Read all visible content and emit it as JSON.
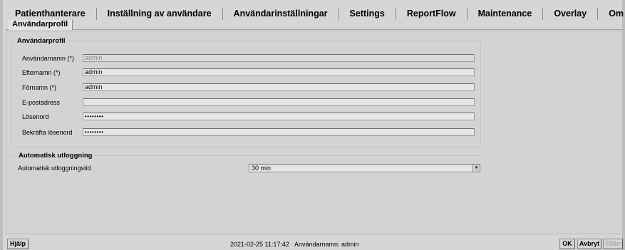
{
  "tabs": [
    {
      "label": "Patienthanterare"
    },
    {
      "label": "Inställning av användare"
    },
    {
      "label": "Användarinställningar"
    },
    {
      "label": "Settings"
    },
    {
      "label": "ReportFlow"
    },
    {
      "label": "Maintenance"
    },
    {
      "label": "Overlay"
    },
    {
      "label": "Om"
    }
  ],
  "subtab": {
    "label": "Användarprofil"
  },
  "profile": {
    "title": "Användarprofil",
    "fields": [
      {
        "label": "Användarnamn (*)",
        "value": "admin",
        "placeholder": ""
      },
      {
        "label": "Efternamn (*)",
        "value": "admin",
        "placeholder": ""
      },
      {
        "label": "Förnamn (*)",
        "value": "admin",
        "placeholder": ""
      },
      {
        "label": "E-postadress",
        "value": "",
        "placeholder": ""
      },
      {
        "label": "Lösenord",
        "value": "••••••••",
        "placeholder": ""
      },
      {
        "label": "Bekräfta lösenord",
        "value": "••••••••",
        "placeholder": ""
      }
    ]
  },
  "logout": {
    "title": "Automatisk utloggning",
    "label": "Automatisk utloggningstid",
    "selected": "30 min"
  },
  "footer": {
    "help_label": "Hjälp",
    "datetime": "2021-02-25  11:17:42",
    "username_label": "Användarnamn:",
    "username": "admin",
    "ok_label": "OK",
    "cancel_label": "Avbryt",
    "apply_label": "Tillämp"
  }
}
